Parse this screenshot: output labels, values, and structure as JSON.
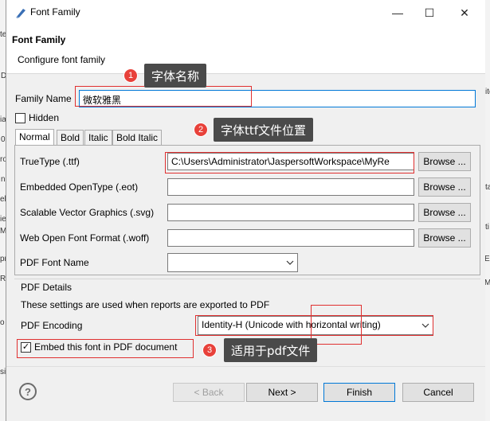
{
  "window": {
    "title": "Font Family",
    "controls": {
      "minimize": "—",
      "maximize": "☐",
      "close": "✕"
    }
  },
  "header": {
    "title": "Font Family",
    "description": "Configure font family"
  },
  "form": {
    "family_name_label": "Family Name",
    "family_name_value": "微软雅黑",
    "hidden_label": "Hidden",
    "hidden_checked": false
  },
  "tabs": [
    {
      "label": "Normal",
      "active": true
    },
    {
      "label": "Bold",
      "active": false
    },
    {
      "label": "Italic",
      "active": false
    },
    {
      "label": "Bold Italic",
      "active": false
    }
  ],
  "normal_tab": {
    "truetype_label": "TrueType (.ttf)",
    "truetype_value": "C:\\Users\\Administrator\\JaspersoftWorkspace\\MyRe",
    "eot_label": "Embedded OpenType (.eot)",
    "eot_value": "",
    "svg_label": "Scalable Vector Graphics (.svg)",
    "svg_value": "",
    "woff_label": "Web Open Font Format (.woff)",
    "woff_value": "",
    "pdf_font_name_label": "PDF Font Name",
    "pdf_font_name_value": "",
    "browse_label": "Browse ..."
  },
  "pdf_details": {
    "group_title": "PDF Details",
    "description": "These settings are used when reports are exported to PDF",
    "encoding_label": "PDF Encoding",
    "encoding_value": "Identity-H (Unicode with horizontal writing)",
    "embed_label": "Embed this font in PDF document",
    "embed_checked": true
  },
  "annotations": [
    {
      "number": "1",
      "text": "字体名称"
    },
    {
      "number": "2",
      "text": "字体ttf文件位置"
    },
    {
      "number": "3",
      "text": "适用于pdf文件"
    }
  ],
  "footer": {
    "help": "?",
    "back": "< Back",
    "next": "Next >",
    "finish": "Finish",
    "cancel": "Cancel"
  },
  "background_fragments": [
    "te",
    "D",
    "ial",
    "0",
    "ro",
    "n",
    "el",
    "ie",
    "Ma",
    "pr",
    "Re",
    "ite",
    "Ma",
    "o",
    "si",
    "ta",
    "ti",
    "Ex"
  ],
  "colors": {
    "highlight": "#e03030",
    "callout_bg": "#4a4a4a",
    "callout_num": "#e8413a",
    "focus_border": "#0078d7"
  }
}
